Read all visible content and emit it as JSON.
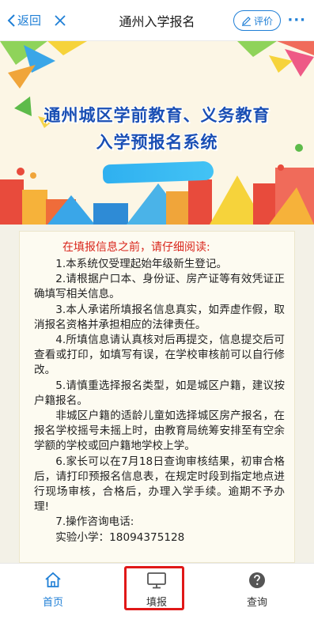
{
  "topbar": {
    "back_label": "返回",
    "title": "通州入学报名",
    "rate_label": "评价",
    "more_label": "···"
  },
  "banner": {
    "title_line1": "通州城区学前教育、义务教育",
    "title_line2": "入学预报名系统"
  },
  "notice": {
    "heading": "在填报信息之前，请仔细阅读:",
    "paragraphs": [
      "1.本系统仅受理起始年级新生登记。",
      "2.请根据户口本、身份证、房产证等有效凭证正确填写相关信息。",
      "3.本人承诺所填报名信息真实，如弄虚作假，取消报名资格并承担相应的法律责任。",
      "4.所填信息请认真核对后再提交，信息提交后可查看或打印，如填写有误，在学校审核前可以自行修改。",
      "5.请慎重选择报名类型，如是城区户籍，建议按户籍报名。",
      "非城区户籍的适龄儿童如选择城区房产报名，在报名学校摇号未摇上时，由教育局统筹安排至有空余学额的学校或回户籍地学校上学。",
      "6.家长可以在7月18日查询审核结果，初审合格后，请打印预报名信息表，在规定时段到指定地点进行现场审核，合格后，办理入学手续。逾期不予办理!",
      "7.操作咨询电话:",
      "实验小学：18094375128"
    ]
  },
  "tabs": [
    {
      "label": "首页",
      "icon": "home-icon"
    },
    {
      "label": "填报",
      "icon": "monitor-icon"
    },
    {
      "label": "查询",
      "icon": "question-icon"
    }
  ],
  "colors": {
    "accent": "#1f7fd6",
    "notice_heading": "#d9261c",
    "highlight_box": "#e01818",
    "banner_title": "#1a4fb4"
  }
}
